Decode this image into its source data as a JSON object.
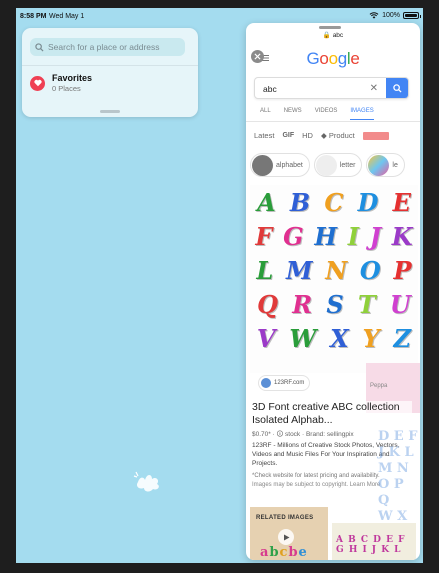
{
  "status_bar": {
    "time": "8:58 PM",
    "date": "Wed May 1",
    "battery": "100%",
    "battery_level": 1.0
  },
  "maps": {
    "search_placeholder": "Search for a place or address",
    "favorites_title": "Favorites",
    "favorites_count": "0 Places"
  },
  "safari": {
    "url": "🔒 abc",
    "google_logo": "Google",
    "query": "abc",
    "tabs": [
      "ALL",
      "NEWS",
      "VIDEOS",
      "IMAGES"
    ],
    "active_tab": "IMAGES",
    "filters": [
      "Latest",
      "GIF",
      "HD",
      "Product"
    ],
    "chips": [
      "alphabet",
      "letter",
      "le"
    ],
    "abc_rows": [
      [
        "A",
        "B",
        "C",
        "D",
        "E"
      ],
      [
        "F",
        "G",
        "H",
        "I",
        "J",
        "K"
      ],
      [
        "L",
        "M",
        "N",
        "O",
        "P"
      ],
      [
        "Q",
        "R",
        "S",
        "T",
        "U"
      ],
      [
        "V",
        "W",
        "X",
        "Y",
        "Z"
      ]
    ],
    "source": "123RF.com",
    "result_title": "3D Font creative ABC collection Isolated Alphab...",
    "result_meta": "$0.70* · 🛈 stock · Brand: sellingpix",
    "result_desc": "123RF - Millions of Creative Stock Photos, Vectors, Videos and Music Files For Your Inspiration and Projects.",
    "result_check": "*Check website for latest pricing and availability.",
    "result_copyright": "Images may be subject to copyright. Learn More",
    "related_label": "RELATED IMAGES",
    "related_abc": "abcbe",
    "related_abc_2": "A B C D E F G H I J K L",
    "side_image_label": "Peppa",
    "right_art": "D E F\nJ K L\nM N O P Q\nW X Y Z"
  },
  "colors": {
    "screen_bg": "#a4dcef",
    "favorites_red": "#ef4054",
    "google_blue": "#4285f4",
    "letter_colors": [
      "#2a9d3a",
      "#2f5fd6",
      "#f0a020",
      "#1e8fe0",
      "#e53030",
      "#e03a3a",
      "#e03090",
      "#1f6fd0",
      "#8fd03a",
      "#d040d0",
      "#9b3ac8"
    ]
  }
}
